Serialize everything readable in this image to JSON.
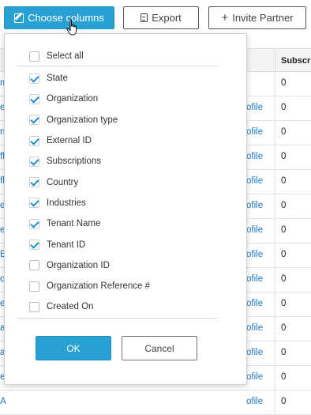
{
  "toolbar": {
    "choose_columns_label": "Choose columns",
    "export_label": "Export",
    "invite_partner_label": "Invite Partner"
  },
  "table": {
    "header_partial": "Subscri",
    "rows": [
      {
        "left": "m",
        "link": "",
        "value": "0"
      },
      {
        "left": "er",
        "link": "ofile",
        "value": "0"
      },
      {
        "left": "ni",
        "link": "ofile",
        "value": "0"
      },
      {
        "left": "ffl",
        "link": "ofile",
        "value": "0"
      },
      {
        "left": "fl",
        "link": "ofile",
        "value": "0"
      },
      {
        "left": "e",
        "link": "ofile",
        "value": "0"
      },
      {
        "left": "e",
        "link": "ofile",
        "value": "0"
      },
      {
        "left": "B",
        "link": "ofile",
        "value": "0"
      },
      {
        "left": "o",
        "link": "ofile",
        "value": "0"
      },
      {
        "left": "e",
        "link": "ofile",
        "value": "0"
      },
      {
        "left": "a",
        "link": "ofile",
        "value": "0"
      },
      {
        "left": "al",
        "link": "ofile",
        "value": "0"
      },
      {
        "left": "e",
        "link": "ofile",
        "value": "0"
      },
      {
        "left": "A",
        "link": "ofile",
        "value": "0"
      }
    ]
  },
  "column_chooser": {
    "select_all_label": "Select all",
    "options": [
      {
        "label": "State",
        "checked": true
      },
      {
        "label": "Organization",
        "checked": true
      },
      {
        "label": "Organization type",
        "checked": true
      },
      {
        "label": "External ID",
        "checked": true
      },
      {
        "label": "Subscriptions",
        "checked": true
      },
      {
        "label": "Country",
        "checked": true
      },
      {
        "label": "Industries",
        "checked": true
      },
      {
        "label": "Tenant Name",
        "checked": true
      },
      {
        "label": "Tenant ID",
        "checked": true
      },
      {
        "label": "Organization ID",
        "checked": false
      },
      {
        "label": "Organization Reference #",
        "checked": false
      },
      {
        "label": "Created On",
        "checked": false
      }
    ],
    "ok_label": "OK",
    "cancel_label": "Cancel"
  },
  "colors": {
    "primary": "#29a0d3",
    "link": "#1f7ac4",
    "checkmark": "#1a8ecf"
  }
}
